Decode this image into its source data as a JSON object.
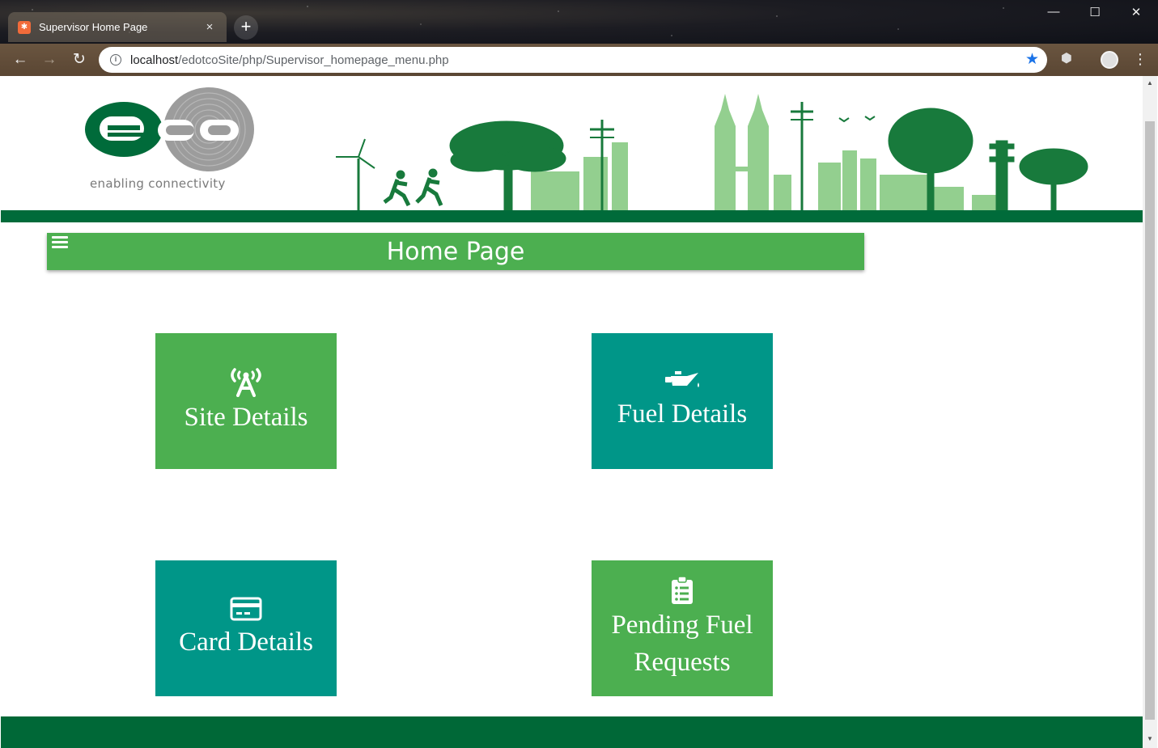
{
  "browser": {
    "tab_title": "Supervisor Home Page",
    "tab_favicon": "xampp-icon",
    "tab_close": "×",
    "new_tab": "+",
    "url_host": "localhost",
    "url_path": "/edotcoSite/php/Supervisor_homepage_menu.php",
    "window_controls": {
      "minimize": "—",
      "maximize": "☐",
      "close": "✕"
    }
  },
  "header": {
    "logo_text": "e.co",
    "tagline": "enabling connectivity"
  },
  "title_bar": {
    "title": "Home Page",
    "menu_icon": "hamburger-icon"
  },
  "tiles": [
    {
      "label": "Site Details",
      "icon": "broadcast-tower-icon",
      "color": "#4caf50"
    },
    {
      "label": "Fuel Details",
      "icon": "oil-can-icon",
      "color": "#009688"
    },
    {
      "label": "Card Details",
      "icon": "credit-card-icon",
      "color": "#009688"
    },
    {
      "label_line1": "Pending Fuel",
      "label_line2": "Requests",
      "icon": "clipboard-list-icon",
      "color": "#4caf50"
    }
  ],
  "colors": {
    "brand_dark_green": "#006b3a",
    "title_green": "#4caf50",
    "teal": "#009688",
    "footer_green": "#006837"
  }
}
